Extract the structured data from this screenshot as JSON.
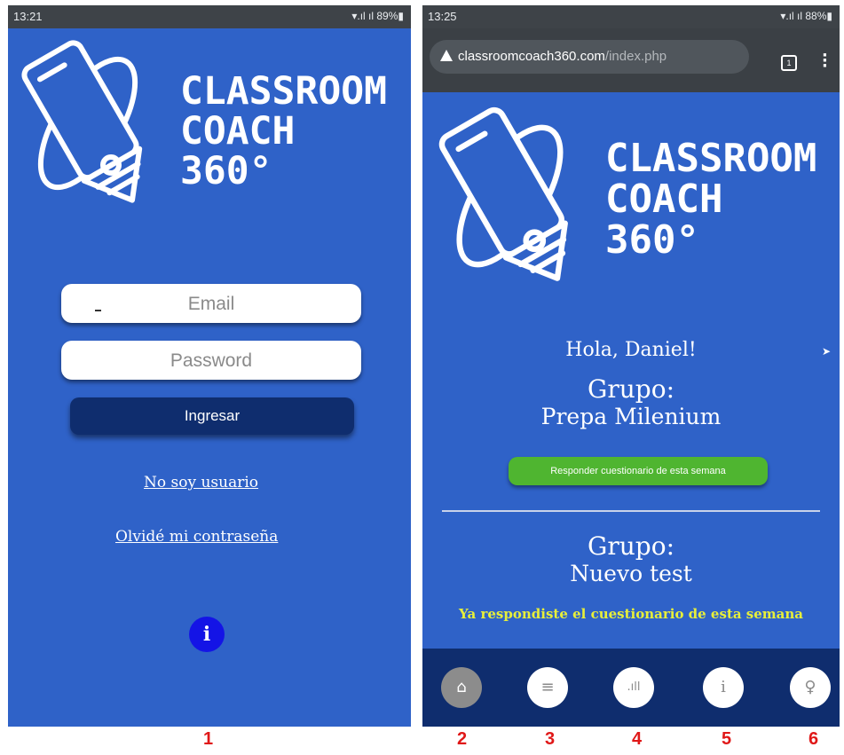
{
  "screen1": {
    "status": {
      "time": "13:21",
      "indicators": "▾.ıl ıl 89%▮"
    },
    "brand": {
      "line1": "CLASSROOM",
      "line2": "COACH",
      "line3": "360°"
    },
    "email_placeholder": "Email",
    "password_placeholder": "Password",
    "login_button": "Ingresar",
    "link_not_user": "No soy usuario",
    "link_forgot": "Olvidé mi contraseña",
    "info_icon": "i"
  },
  "screen2": {
    "status": {
      "time": "13:25",
      "indicators": "▾.ıl ıl 88%▮"
    },
    "browser": {
      "url_host": "classroomcoach360.com",
      "url_path": "/index.php",
      "tab_count": "1"
    },
    "brand": {
      "line1": "CLASSROOM",
      "line2": "COACH",
      "line3": "360°"
    },
    "greeting": "Hola, Daniel!",
    "groups": [
      {
        "label": "Grupo:",
        "name": "Prepa Milenium",
        "action": "Responder cuestionario de esta semana"
      },
      {
        "label": "Grupo:",
        "name": "Nuevo test",
        "status": "Ya respondiste el cuestionario de esta semana"
      }
    ],
    "nav": [
      {
        "icon": "home-icon",
        "glyph": "⌂",
        "active": true
      },
      {
        "icon": "traffic-light-icon",
        "glyph": "≡",
        "active": false
      },
      {
        "icon": "signal-bars-icon",
        "glyph": ".ıll",
        "active": false
      },
      {
        "icon": "info-icon",
        "glyph": "i",
        "active": false
      },
      {
        "icon": "user-icon",
        "glyph": "♀",
        "active": false
      }
    ]
  },
  "labels": [
    "1",
    "2",
    "3",
    "4",
    "5",
    "6"
  ],
  "colors": {
    "background_blue": "#2f62c8",
    "dark_navy": "#0f2d6e",
    "green": "#4fb530",
    "yellow_text": "#e7ef3a",
    "info_blue": "#1414e6",
    "label_red": "#e01818"
  }
}
